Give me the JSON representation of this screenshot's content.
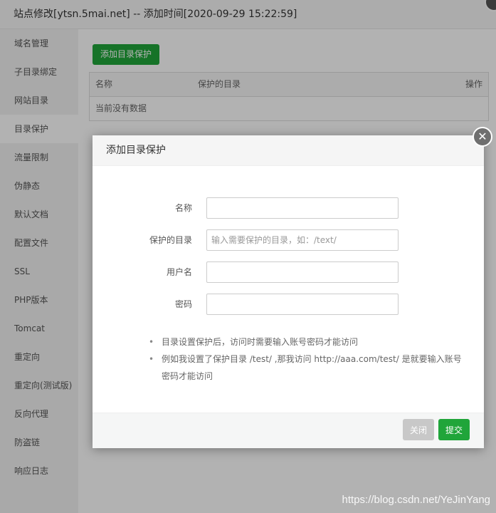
{
  "window": {
    "title": "站点修改[ytsn.5mai.net] -- 添加时间[2020-09-29 15:22:59]"
  },
  "sidebar": {
    "items": [
      {
        "label": "域名管理"
      },
      {
        "label": "子目录绑定"
      },
      {
        "label": "网站目录"
      },
      {
        "label": "目录保护",
        "active": true
      },
      {
        "label": "流量限制"
      },
      {
        "label": "伪静态"
      },
      {
        "label": "默认文档"
      },
      {
        "label": "配置文件"
      },
      {
        "label": "SSL"
      },
      {
        "label": "PHP版本"
      },
      {
        "label": "Tomcat"
      },
      {
        "label": "重定向"
      },
      {
        "label": "重定向(测试版)"
      },
      {
        "label": "反向代理"
      },
      {
        "label": "防盗链"
      },
      {
        "label": "响应日志"
      }
    ]
  },
  "main": {
    "add_button": "添加目录保护",
    "table": {
      "headers": {
        "name": "名称",
        "dir": "保护的目录",
        "op": "操作"
      },
      "empty_text": "当前没有数据"
    }
  },
  "dialog": {
    "title": "添加目录保护",
    "close_icon": "✕",
    "fields": [
      {
        "label": "名称",
        "value": "",
        "placeholder": ""
      },
      {
        "label": "保护的目录",
        "value": "",
        "placeholder": "输入需要保护的目录，如：/text/"
      },
      {
        "label": "用户名",
        "value": "",
        "placeholder": ""
      },
      {
        "label": "密码",
        "value": "",
        "placeholder": ""
      }
    ],
    "tips": [
      "目录设置保护后，访问时需要输入账号密码才能访问",
      "例如我设置了保护目录 /test/ ,那我访问 http://aaa.com/test/ 是就要输入账号密码才能访问"
    ],
    "buttons": {
      "close": "关闭",
      "submit": "提交"
    }
  },
  "watermark": "https://blog.csdn.net/YeJinYang",
  "colors": {
    "accent": "#20a53a",
    "close_button": "#c8c8c8"
  }
}
